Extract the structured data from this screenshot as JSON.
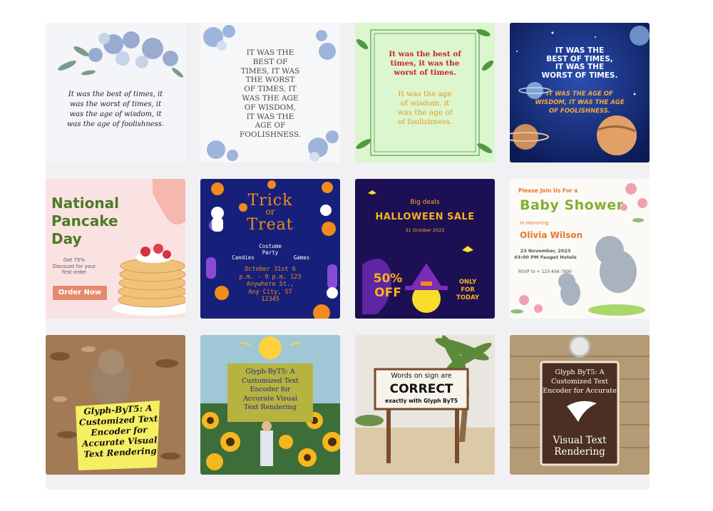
{
  "tiles": [
    {
      "id": "t1",
      "texts": {
        "quote": "It was the best of times, it\nwas the worst of times, it\nwas the age of wisdom, it\nwas the age of foolishness."
      }
    },
    {
      "id": "t2",
      "texts": {
        "quote": "IT WAS THE\nBEST OF\nTIMES, IT WAS\nTHE WORST\nOF TIMES, IT\nWAS THE AGE\nOF WISDOM,\nIT WAS THE\nAGE OF\nFOOLISHNESS."
      }
    },
    {
      "id": "t3",
      "texts": {
        "red": "It was the best of\ntimes, it was the\nworst of times.",
        "orange": "It was the age\nof wisdom, it\nwas the age of\nof foolishness."
      }
    },
    {
      "id": "t4",
      "texts": {
        "white": "IT WAS THE\nBEST OF TIMES,\nIT WAS THE\nWORST OF TIMES.",
        "orange": "IT WAS THE AGE OF\nWISDOM, IT WAS THE AGE\nOF FOOLISHNESS."
      }
    },
    {
      "id": "t5",
      "texts": {
        "title": "National\nPancake\nDay",
        "offer": "Get 75%\nDiscount for your\nfirst order",
        "cta": "Order Now"
      }
    },
    {
      "id": "t6",
      "texts": {
        "trick": "Trick",
        "or": "or",
        "treat": "Treat",
        "costume": "Costume\nParty",
        "candies": "Candies",
        "games": "Games",
        "details": "October 31st 6\np.m. - 9 p.m. 123\nAnywhere St.,\nAny City, ST\n12345"
      }
    },
    {
      "id": "t7",
      "texts": {
        "big": "Big deals",
        "sale": "HALLOWEEN SALE",
        "date": "31 October 2022",
        "off": "50%\nOFF",
        "only": "ONLY\nFOR\nTODAY"
      }
    },
    {
      "id": "t8",
      "texts": {
        "join": "Please Join Us For a",
        "shower": "Baby Shower",
        "honoring": "In Honoring",
        "name": "Olivia Wilson",
        "when": "23 November, 2023\n03:00 PM Fauget Hotels",
        "rsvp": "RSVP to + 123-456-7890"
      }
    },
    {
      "id": "t9",
      "texts": {
        "note": "Glyph-ByT5: A\nCustomized Text\nEncoder for\nAccurate Visual\nText Rendering"
      }
    },
    {
      "id": "t10",
      "texts": {
        "sign": "Glyph-ByT5: A\nCustomized Text\nEncoder for\nAccurate Visual\nText Rendering"
      }
    },
    {
      "id": "t11",
      "texts": {
        "line1": "Words on sign are",
        "line2": "CORRECT",
        "line3": "exactly with Glyph ByT5"
      }
    },
    {
      "id": "t12",
      "texts": {
        "top": "Glyph ByT5: A\nCustomized Text\nEncoder for Accurate",
        "bottom": "Visual Text\nRendering"
      }
    }
  ],
  "colors": {
    "panel": "#f1f1f3"
  }
}
